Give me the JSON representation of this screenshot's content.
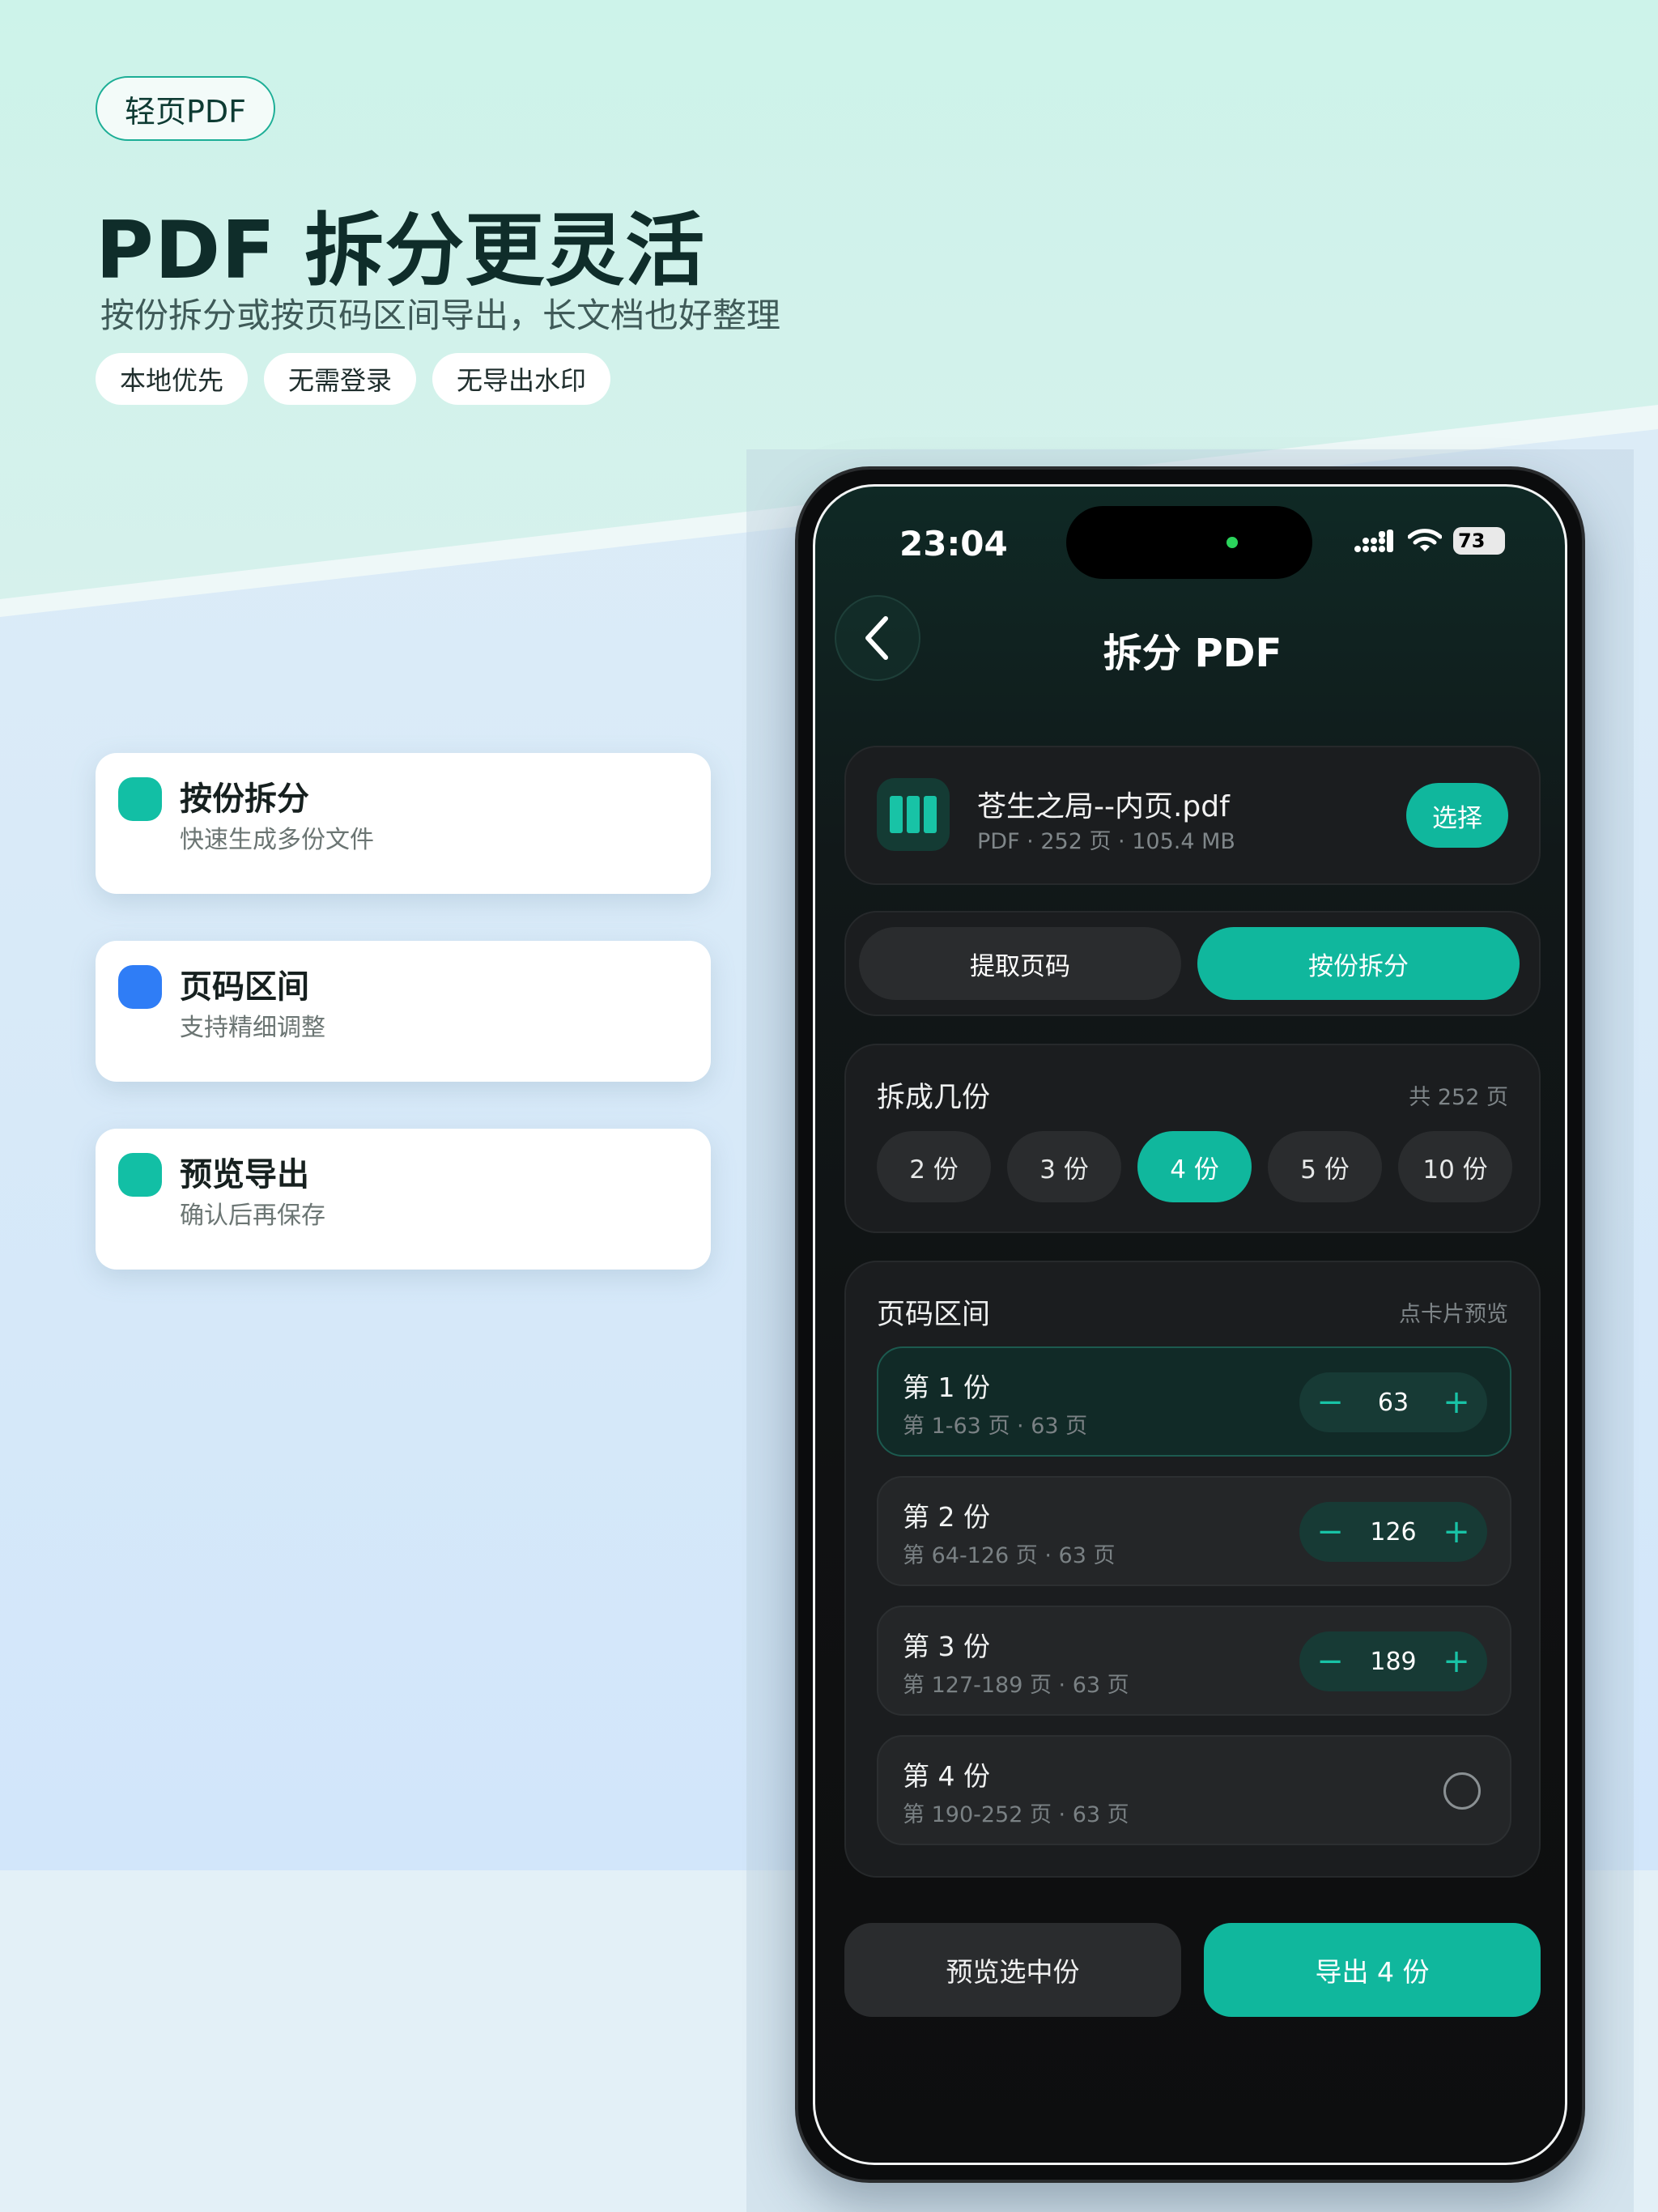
{
  "brand": "轻页PDF",
  "headline": "PDF 拆分更灵活",
  "subheadline": "按份拆分或按页码区间导出，长文档也好整理",
  "tags": [
    "本地优先",
    "无需登录",
    "无导出水印"
  ],
  "features": [
    {
      "title": "按份拆分",
      "subtitle": "快速生成多份文件",
      "color": "#12bfa5"
    },
    {
      "title": "页码区间",
      "subtitle": "支持精细调整",
      "color": "#2f7df6"
    },
    {
      "title": "预览导出",
      "subtitle": "确认后再保存",
      "color": "#12bfa5"
    }
  ],
  "status": {
    "time": "23:04",
    "battery": "73"
  },
  "nav": {
    "title": "拆分 PDF"
  },
  "file": {
    "name": "苍生之局--内页.pdf",
    "meta": "PDF · 252 页 · 105.4 MB",
    "select_label": "选择"
  },
  "mode_tabs": [
    {
      "label": "提取页码",
      "active": false
    },
    {
      "label": "按份拆分",
      "active": true
    }
  ],
  "split_count": {
    "title": "拆成几份",
    "total_note": "共 252 页",
    "options": [
      "2 份",
      "3 份",
      "4 份",
      "5 份",
      "10 份"
    ],
    "selected": "4 份"
  },
  "ranges": {
    "title": "页码区间",
    "hint": "点卡片预览",
    "parts": [
      {
        "title": "第 1 份",
        "range": "第 1-63 页 · 63 页",
        "end": "63",
        "active": true
      },
      {
        "title": "第 2 份",
        "range": "第 64-126 页 · 63 页",
        "end": "126",
        "active": false
      },
      {
        "title": "第 3 份",
        "range": "第 127-189 页 · 63 页",
        "end": "189",
        "active": false
      },
      {
        "title": "第 4 份",
        "range": "第 190-252 页 · 63 页",
        "end": null,
        "active": false
      }
    ]
  },
  "actions": {
    "preview": "预览选中份",
    "export": "导出 4 份"
  },
  "colors": {
    "accent": "#10b79d",
    "blue": "#2f7df6",
    "dark_bg": "#101112"
  }
}
